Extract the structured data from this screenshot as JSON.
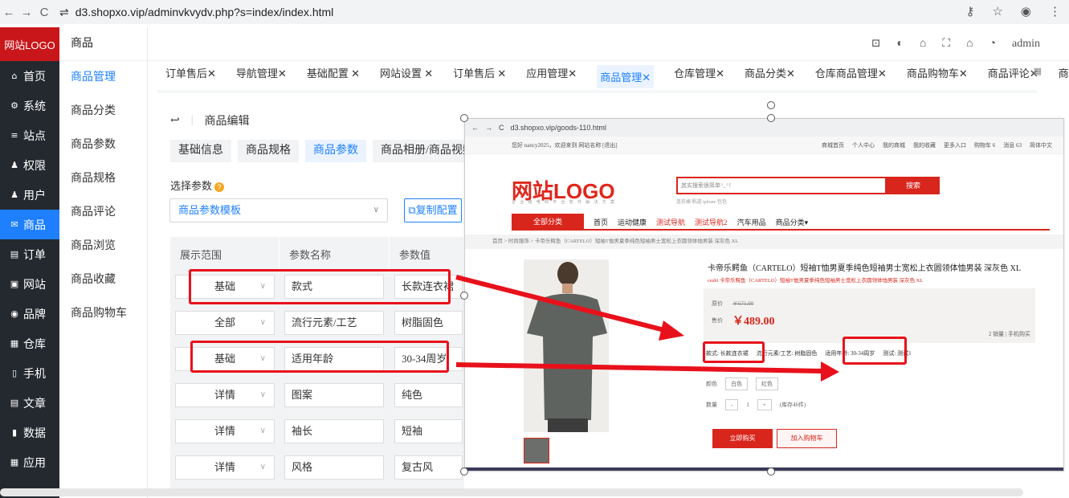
{
  "browser": {
    "url": "d3.shopxo.vip/adminvkvydv.php?s=index/index.html",
    "back": "←",
    "forward": "→",
    "reload": "C"
  },
  "sidebar": {
    "logo": "网站LOGO",
    "items": [
      {
        "icon": "⌂",
        "label": "首页"
      },
      {
        "icon": "⚙",
        "label": "系统"
      },
      {
        "icon": "≡",
        "label": "站点"
      },
      {
        "icon": "♟",
        "label": "权限"
      },
      {
        "icon": "♟",
        "label": "用户"
      },
      {
        "icon": "✉",
        "label": "商品"
      },
      {
        "icon": "▤",
        "label": "订单"
      },
      {
        "icon": "▣",
        "label": "网站"
      },
      {
        "icon": "◉",
        "label": "品牌"
      },
      {
        "icon": "▦",
        "label": "仓库"
      },
      {
        "icon": "▯",
        "label": "手机"
      },
      {
        "icon": "▤",
        "label": "文章"
      },
      {
        "icon": "▮",
        "label": "数据"
      },
      {
        "icon": "▦",
        "label": "应用"
      }
    ]
  },
  "submenu": {
    "title": "商品",
    "items": [
      "商品管理",
      "商品分类",
      "商品参数",
      "商品规格",
      "商品评论",
      "商品浏览",
      "商品收藏",
      "商品购物车"
    ]
  },
  "header": {
    "user": "admin"
  },
  "tabs": [
    "订单售后✕",
    "导航管理✕",
    "基础配置 ✕",
    "网站设置 ✕",
    "订单售后 ✕",
    "应用管理✕",
    "商品管理✕",
    "仓库管理✕",
    "商品分类✕",
    "仓库商品管理✕",
    "商品购物车✕",
    "商品评论✕",
    "商品规"
  ],
  "page": {
    "back_title": "商品编辑",
    "inner_tabs": [
      "基础信息",
      "商品规格",
      "商品参数",
      "商品相册/商品视频"
    ],
    "select_param_label": "选择参数",
    "template_placeholder": "商品参数模板",
    "copy_button": "复制配置"
  },
  "param_table": {
    "headers": [
      "展示范围",
      "参数名称",
      "参数值"
    ],
    "rows": [
      [
        "基础",
        "款式",
        "长款连衣裙"
      ],
      [
        "全部",
        "流行元素/工艺",
        "树脂固色"
      ],
      [
        "基础",
        "适用年龄",
        "30-34周岁"
      ],
      [
        "详情",
        "图案",
        "纯色"
      ],
      [
        "详情",
        "袖长",
        "短袖"
      ],
      [
        "详情",
        "风格",
        "复古风"
      ]
    ]
  },
  "popup": {
    "url": "d3.shopxo.vip/goods-110.html",
    "topbar_left": "您好 nancy2025，欢迎来到 网站名称 [退出]",
    "topbar_right": [
      "商城首页",
      "个人中心",
      "我的商城",
      "我的收藏",
      "更多入口",
      "购物车 6",
      "消息 63",
      "简体中文"
    ],
    "logo": "网站LOGO",
    "logo_sub": "企 业 级 电 商 平 台 软 件 解 决 方 案",
    "search_placeholder": "其实搜索很简单^_^！",
    "search_button": "搜索",
    "hot": "连衣裙  帆道  iphone  包包",
    "nav": [
      "全部分类",
      "首页",
      "运动健康",
      "测试导航",
      "测试导航2",
      "汽车用品",
      "商品分类▾"
    ],
    "breadcrumb": "首页  >  时尚服饰  >  卡帝乐鳄鱼（CARTELO）短袖T恤男夏季纯色短袖男士宽松上衣圆领体恤男装 深灰色 XL",
    "title": "卡帝乐鳄鱼（CARTELO）短袖T恤男夏季纯色短袖男士宽松上衣圆领体恤男装 深灰色 XL",
    "subtitle": "ceshi 卡帝乐鳄鱼（CARTELO）短袖T恤男夏季纯色短袖男士宽松上衣圆领体恤男装 深灰色 XL",
    "original_price_label": "原价",
    "original_price": "￥671.00",
    "sale_label": "售价",
    "sale_price": "￥489.00",
    "sales": "2 销量  |  手机购买",
    "attrs": [
      "款式: 长款连衣裙",
      "流行元素/工艺: 树脂固色",
      "适用年龄: 30-34周岁",
      "测试: 测试1"
    ],
    "color_label": "颜色",
    "colors": [
      "白色",
      "红色"
    ],
    "qty_label": "数量",
    "qty": "1",
    "stock": "(库存46件)",
    "buy_button": "立即购买",
    "cart_button": "加入购物车"
  },
  "colors": {
    "brand": "#1e80ff",
    "sidebar": "#24292f",
    "red": "#e8111b"
  }
}
